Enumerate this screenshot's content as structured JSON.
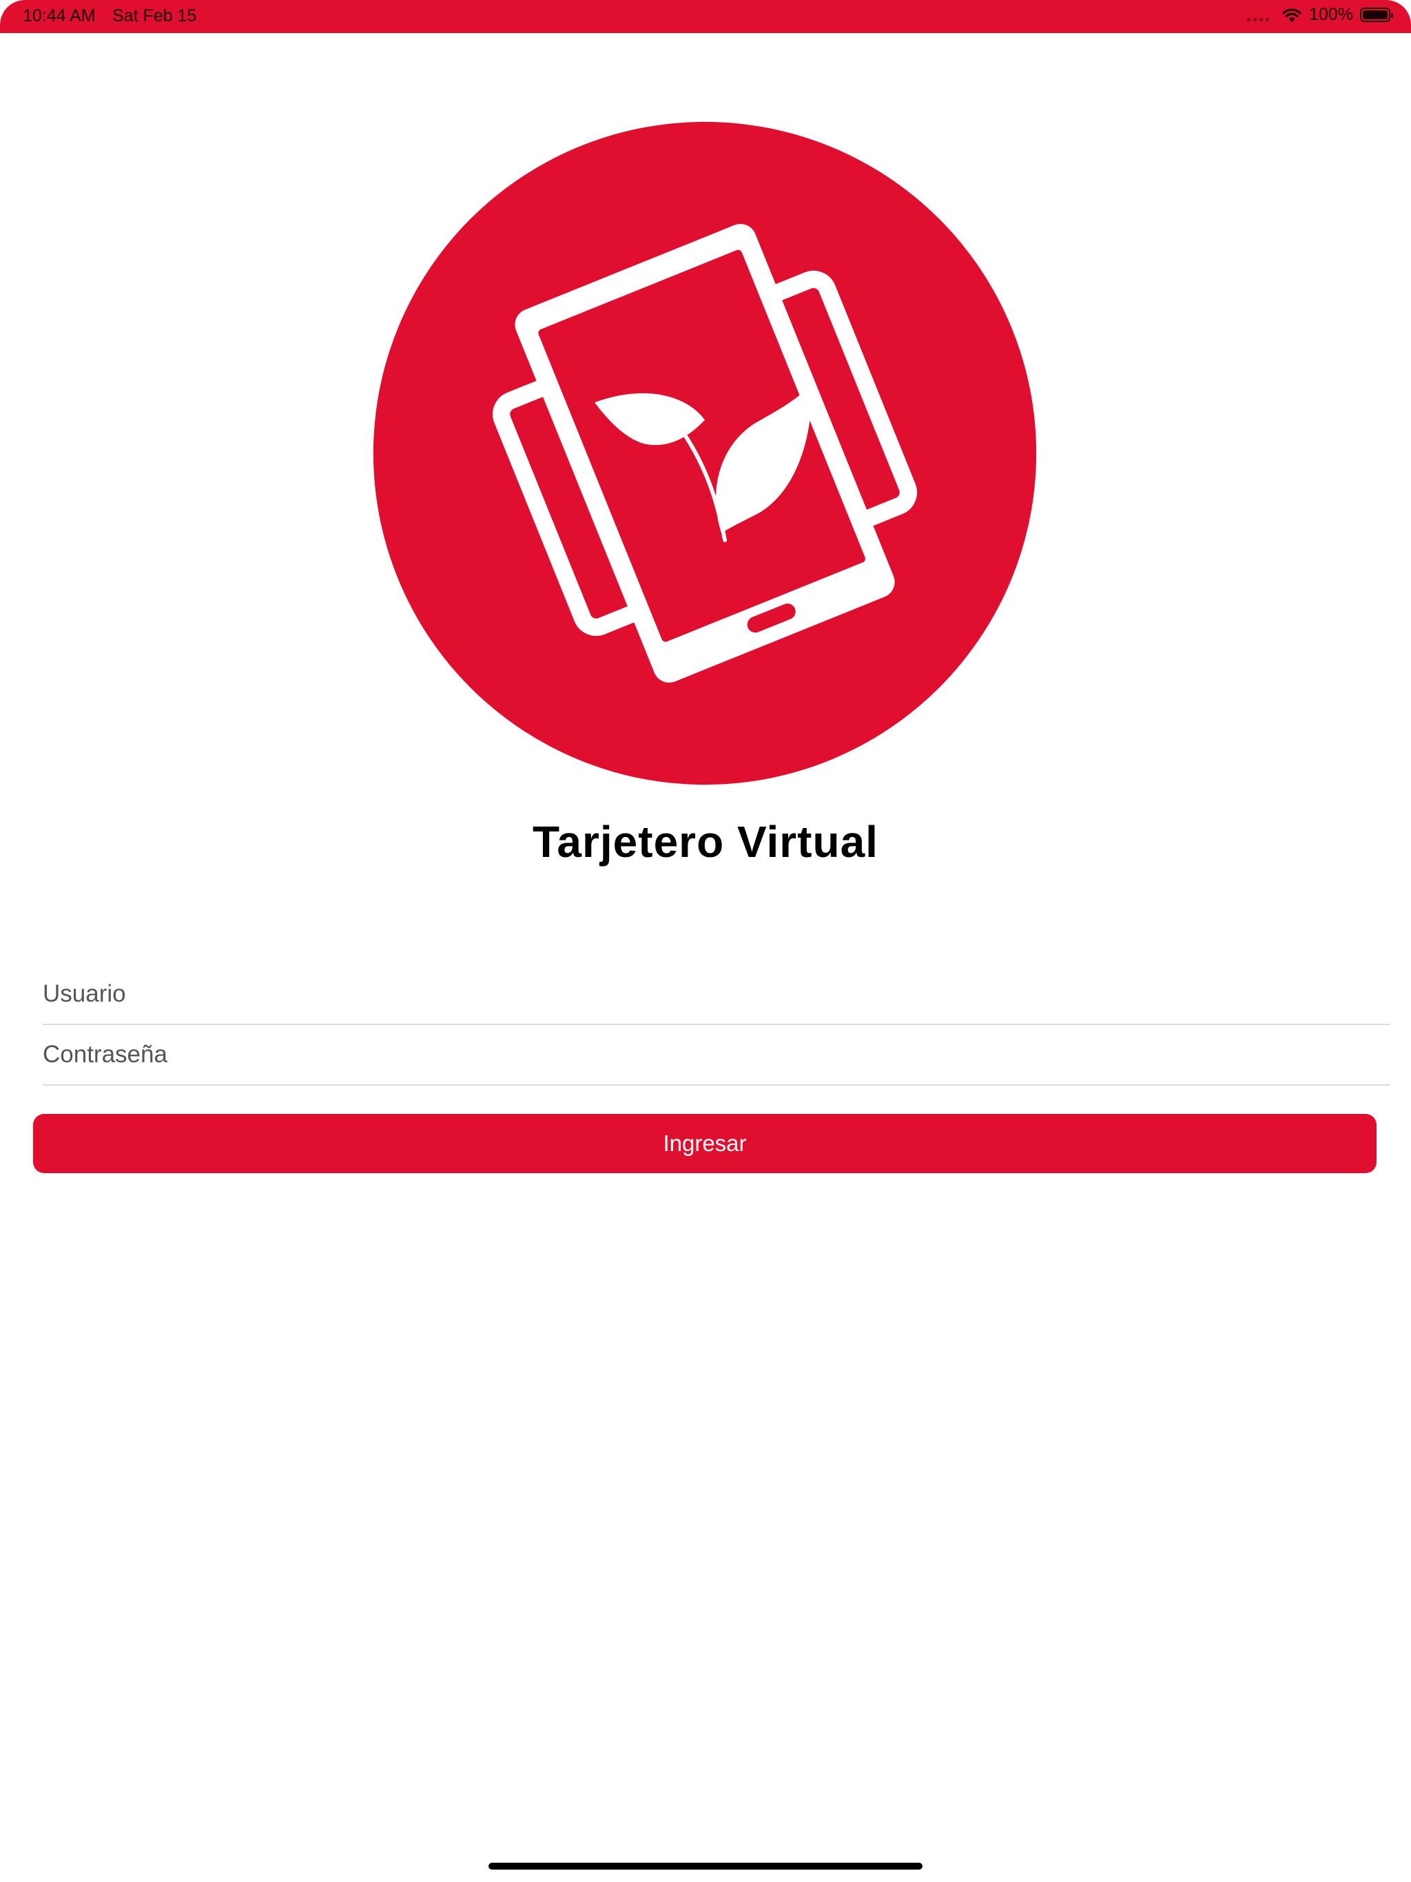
{
  "status_bar": {
    "time": "10:44 AM",
    "date": "Sat Feb 15",
    "battery_percent": "100%",
    "battery_level": 1.0,
    "icons": [
      "signal-dots-icon",
      "wifi-icon",
      "battery-icon"
    ]
  },
  "colors": {
    "brand_red": "#e00e2f",
    "background": "#ffffff",
    "text": "#000000"
  },
  "logo": {
    "icon": "rotating-phone-leaf-logo"
  },
  "app_title": "Tarjetero Virtual",
  "form": {
    "username": {
      "value": "",
      "placeholder": "Usuario"
    },
    "password": {
      "value": "",
      "placeholder": "Contraseña"
    },
    "submit_label": "Ingresar"
  }
}
